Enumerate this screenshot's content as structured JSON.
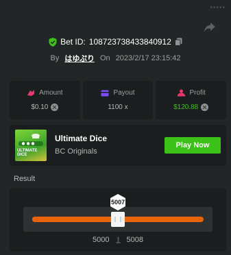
{
  "header": {
    "top_right": "•••••",
    "bet_id_label": "Bet ID:",
    "bet_id": "108723738433840912",
    "by_label": "By",
    "username": "はゆぷり",
    "on_label": "On",
    "timestamp": "2023/2/17 23:15:42"
  },
  "stats": [
    {
      "label": "Amount",
      "value": "$0.10",
      "icon": "money-bag-icon",
      "color": "#e8386b"
    },
    {
      "label": "Payout",
      "value": "1100 x",
      "icon": "wallet-icon",
      "color": "#7b4dff"
    },
    {
      "label": "Profit",
      "value": "$120.88",
      "icon": "profit-icon",
      "color": "#e8386b"
    }
  ],
  "game": {
    "thumb_text": "ULTIMATE DICE",
    "title": "Ultimate Dice",
    "subtitle": "BC Originals",
    "play_label": "Play Now"
  },
  "result": {
    "label": "Result",
    "value": "5007",
    "range_min": "5000",
    "range_max": "5008",
    "slider_min": 0,
    "slider_max": 10000
  },
  "colors": {
    "accent_green": "#3bc117",
    "slider_orange": "#e8630a",
    "background": "#232626",
    "card": "#1b1e1e"
  }
}
